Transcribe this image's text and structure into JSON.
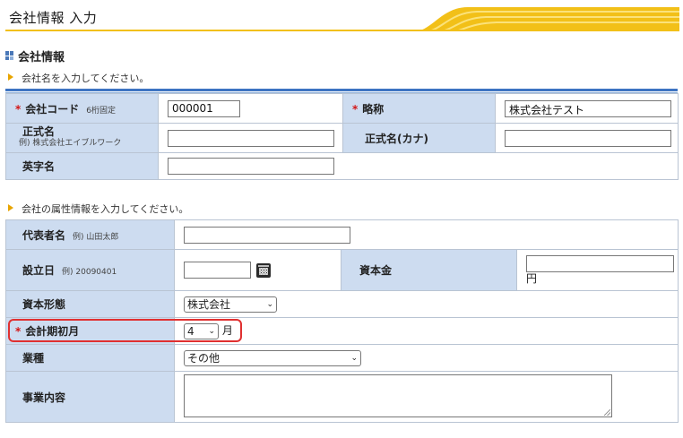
{
  "header": {
    "title": "会社情報 入力"
  },
  "section": {
    "title": "会社情報",
    "note1": "会社名を入力してください。",
    "note2": "会社の属性情報を入力してください。"
  },
  "company": {
    "code": {
      "label": "会社コード",
      "hint": "6桁固定",
      "value": "000001",
      "required": "*"
    },
    "abbr": {
      "label": "略称",
      "value": "株式会社テスト",
      "required": "*"
    },
    "formal": {
      "label": "正式名",
      "hint": "例) 株式会社エイブルワーク",
      "value": ""
    },
    "formal_kana": {
      "label": "正式名(カナ)",
      "value": ""
    },
    "english": {
      "label": "英字名",
      "value": ""
    }
  },
  "attributes": {
    "representative": {
      "label": "代表者名",
      "hint": "例) 山田太郎",
      "value": ""
    },
    "established": {
      "label": "設立日",
      "hint": "例) 20090401",
      "value": ""
    },
    "capital": {
      "label": "資本金",
      "value": "",
      "unit": "円"
    },
    "capital_form": {
      "label": "資本形態",
      "selected": "株式会社"
    },
    "fiscal_start": {
      "label": "会計期初月",
      "selected": "4",
      "unit": "月",
      "required": "*"
    },
    "industry": {
      "label": "業種",
      "selected": "その他"
    },
    "business": {
      "label": "事業内容",
      "value": ""
    }
  },
  "colors": {
    "label_bg": "#cddcf0",
    "accent": "#f2c018",
    "required": "#d31616",
    "highlight": "#e03030"
  }
}
